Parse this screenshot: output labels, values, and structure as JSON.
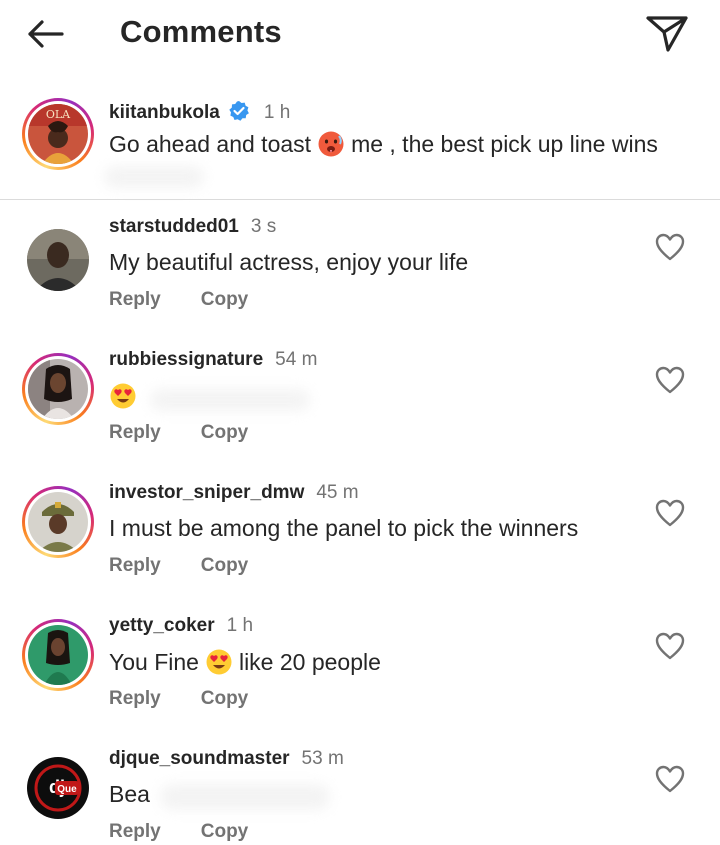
{
  "header": {
    "title": "Comments"
  },
  "caption": {
    "username": "kiitanbukola",
    "time": "1 h",
    "text_before": "Go ahead and toast",
    "text_after": "me , the best pick up line wins",
    "avatar_text": "OLA"
  },
  "comments": [
    {
      "username": "starstudded01",
      "time": "3 s",
      "text": "My beautiful actress, enjoy your life",
      "reply": "Reply",
      "copy": "Copy"
    },
    {
      "username": "rubbiessignature",
      "time": "54 m",
      "text": "",
      "reply": "Reply",
      "copy": "Copy"
    },
    {
      "username": "investor_sniper_dmw",
      "time": "45 m",
      "text": "I must be among the panel to pick the winners",
      "reply": "Reply",
      "copy": "Copy"
    },
    {
      "username": "yetty_coker",
      "time": "1 h",
      "text_before": "You Fine",
      "text_after": "like 20 people",
      "reply": "Reply",
      "copy": "Copy"
    },
    {
      "username": "djque_soundmaster",
      "time": "53 m",
      "text": "Bea",
      "reply": "Reply",
      "copy": "Copy",
      "avatar_text": "Que"
    }
  ],
  "colors": {
    "verified": "#3897f0",
    "secondary_text": "#737373",
    "primary_text": "#262626"
  }
}
